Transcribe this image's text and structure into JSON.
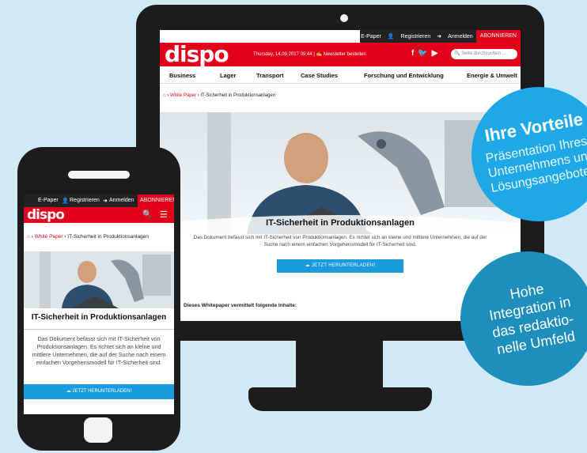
{
  "desktop": {
    "topbar": {
      "epaper": "E-Paper",
      "register": "Registrieren",
      "login": "Anmelden",
      "subscribe": "ABONNIEREN"
    },
    "logo": "dispo",
    "datestr": "Thursday, 14.09.2017 09:44 | ✍ Newsletter bestellen",
    "search_placeholder": "Seite durchsuchen ...",
    "nav": [
      "Business",
      "Lager",
      "Transport",
      "Case Studies",
      "Forschung und Entwicklung",
      "Energie & Umwelt"
    ],
    "breadcrumb": {
      "section": "White Paper",
      "page": "IT-Sicherheit in Produktionsanlagen"
    },
    "title": "IT-Sicherheit in Produktionsanlagen",
    "description": "Das Dokument befasst sich mit IT-Sicherheit von Produktionsanlagen. Es richtet sich an kleine und mittlere Unternehmen, die auf der Suche nach einem einfachen Vorgehensmodell für IT-Sicherheit sind.",
    "download_label": "JETZT HERUNTERLADEN!",
    "contents_heading": "Dieses Whitepaper vermittelt folgende Inhalte:"
  },
  "mobile": {
    "topbar": {
      "epaper": "E-Paper",
      "register": "Registrieren",
      "login": "Anmelden",
      "subscribe": "ABONNIEREN"
    },
    "logo": "dispo",
    "breadcrumb": {
      "section": "White Paper",
      "page": "IT-Sicherheit in Produktionsanlagen"
    },
    "title": "IT-Sicherheit in Produktionsanlagen",
    "description": "Das Dokument befasst sich mit IT-Sicherheit von Produktionsanlagen. Es richtet sich an kleine und mittlere Unternehmen, die auf der Suche nach einem einfachen Vorgehensmodell für IT-Sicherheit sind.",
    "download_label": "JETZT HERUNTERLADEN!"
  },
  "badges": {
    "b1_title": "Ihre Vorteile",
    "b1_text": [
      "Präsentation Ihres",
      "Unternehmens und",
      "Lösungsangebotes"
    ],
    "b2_text": [
      "Hohe",
      "Integration in",
      "das redaktio-",
      "nelle Umfeld"
    ]
  },
  "colors": {
    "brand_red": "#e2001a",
    "accent_blue": "#1a9be0",
    "badge_light": "#1ea8e8",
    "badge_dark": "#1e8fbd"
  }
}
